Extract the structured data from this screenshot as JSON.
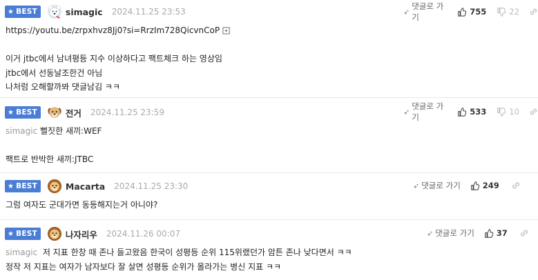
{
  "badge_label": "BEST",
  "reply_label": "댓글로 가기",
  "comments": [
    {
      "nickname": "simagic",
      "date": "2024.11.25 23:53",
      "likes": "755",
      "dislikes": "22",
      "avatar": "polar-bear-avatar",
      "lines": [
        "https://youtu.be/zrpxhvz8Jj0?si=RrzIm728QicvnCoP",
        "",
        "이거 jtbc에서 남녀평등 지수 이상하다고 팩트체크 하는 영상임",
        "jtbc에서 선동날조한건 아님",
        "나처럼 오해할까봐 댓글남김 ㅋㅋ"
      ]
    },
    {
      "nickname": "전거",
      "date": "2024.11.25 23:59",
      "likes": "533",
      "dislikes": "10",
      "avatar": "puppy-avatar",
      "mention": "simagic",
      "lines": [
        "뻘짓한 새끼:WEF",
        "",
        "팩트로 반박한 새끼:JTBC"
      ]
    },
    {
      "nickname": "Macarta",
      "date": "2024.11.25 23:30",
      "likes": "249",
      "avatar": "lion-avatar",
      "lines": [
        "그럼 여자도 군대가면 동등해지는거 아니야?"
      ]
    },
    {
      "nickname": "나자리우",
      "date": "2024.11.26 00:07",
      "likes": "37",
      "avatar": "lion-avatar",
      "mention": "simagic",
      "lines": [
        "저 지표 한창 때 존나 들고왔음 한국이 성평등 순위 115위랬던가 암튼 존나 낮다면서 ㅋㅋ",
        "정작 저 지표는 여자가 남자보다 잘 살면 성평등 순위가 올라가는 병신 지표 ㅋㅋ"
      ]
    }
  ]
}
